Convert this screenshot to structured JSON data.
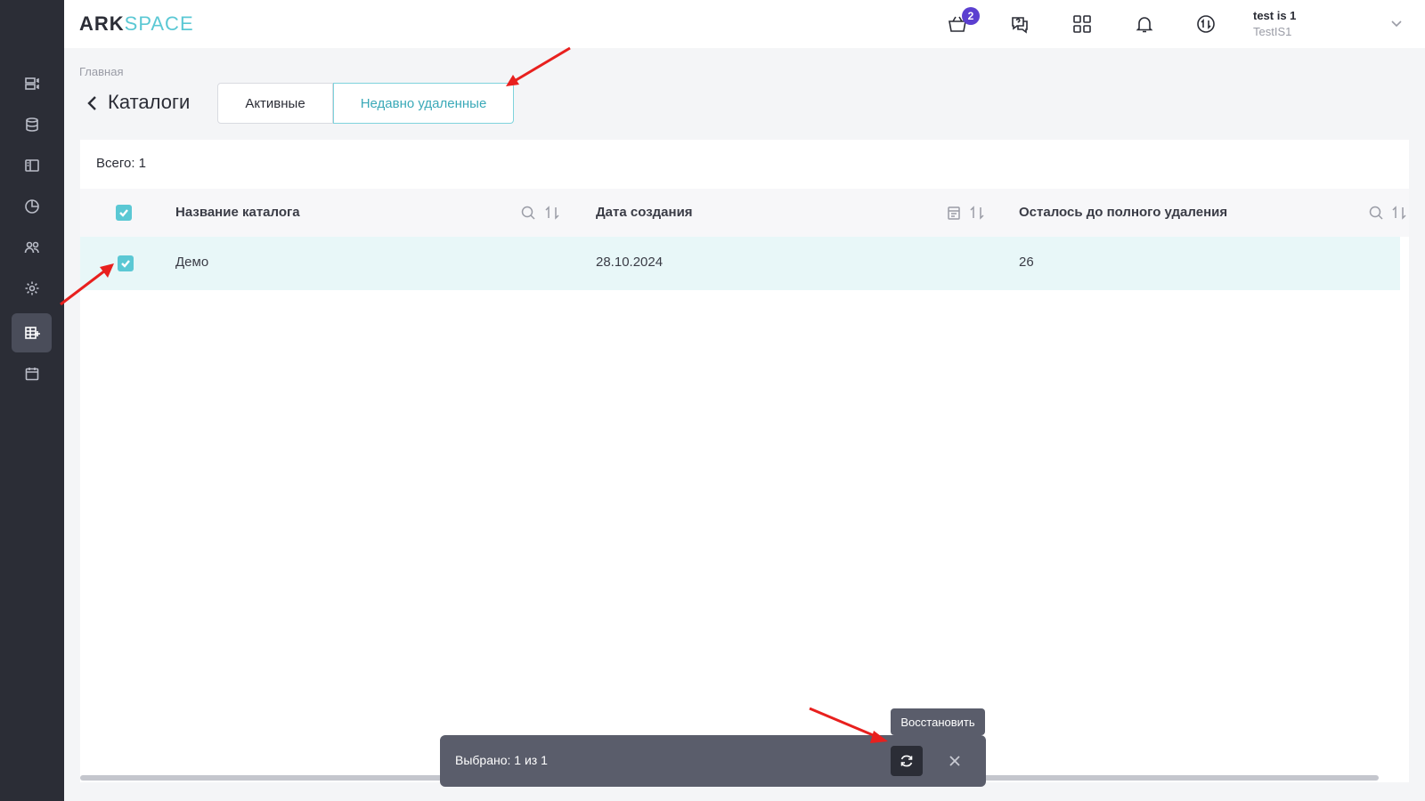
{
  "logo": {
    "part1": "ARK",
    "part2": "SPACE"
  },
  "header": {
    "cart_badge": "2",
    "user_name": "test is 1",
    "user_sub": "TestIS1"
  },
  "breadcrumb": "Главная",
  "page_title": "Каталоги",
  "tabs": [
    {
      "label": "Активные",
      "active": false
    },
    {
      "label": "Недавно удаленные",
      "active": true
    }
  ],
  "total": "Всего: 1",
  "table": {
    "columns": [
      "Название каталога",
      "Дата создания",
      "Осталось до полного удаления"
    ],
    "rows": [
      {
        "name": "Демо",
        "date": "28.10.2024",
        "remaining": "26",
        "checked": true
      }
    ]
  },
  "selection_bar": {
    "label": "Выбрано: 1 из 1",
    "tooltip": "Восстановить"
  },
  "colors": {
    "accent": "#5bc8d4",
    "sidebar": "#2b2d36",
    "badge": "#5b3fd0",
    "annotation": "#e8201e"
  }
}
